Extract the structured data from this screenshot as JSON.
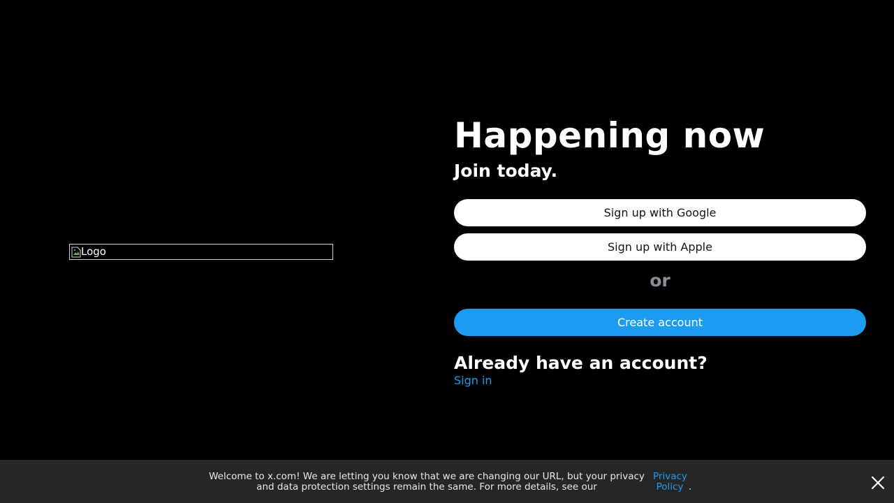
{
  "logo": {
    "alt_text": "Logo",
    "icon": "broken-image-icon"
  },
  "hero": {
    "headline": "Happening now",
    "subheadline": "Join today."
  },
  "signup": {
    "google_label": "Sign up with Google",
    "apple_label": "Sign up with Apple",
    "divider": "or",
    "create_label": "Create account"
  },
  "signin": {
    "prompt": "Already have an account?",
    "link_label": "Sign in"
  },
  "banner": {
    "message": "Welcome to x.com! We are letting you know that we are changing our URL, but your privacy and data protection settings remain the same. For more details, see our",
    "link_label": "Privacy Policy",
    "trailing": ".",
    "close_icon": "close-icon"
  },
  "colors": {
    "background": "#000000",
    "accent": "#1d9bf0",
    "button_light": "#ffffff",
    "banner_bg": "#262626",
    "muted": "#8b8f93"
  }
}
